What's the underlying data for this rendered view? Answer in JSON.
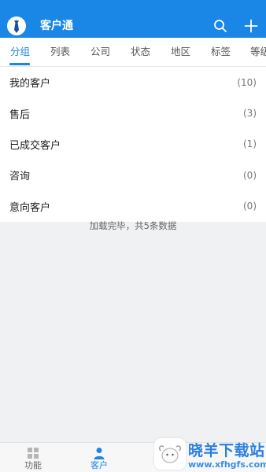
{
  "header": {
    "title": "客户通",
    "avatar_icon": "tie-icon",
    "search_icon": "search-icon",
    "add_icon": "plus-icon",
    "color": "#1a86e6"
  },
  "tabs": [
    {
      "label": "分组",
      "active": true
    },
    {
      "label": "列表"
    },
    {
      "label": "公司"
    },
    {
      "label": "状态"
    },
    {
      "label": "地区"
    },
    {
      "label": "标签"
    },
    {
      "label": "等级"
    }
  ],
  "groups": [
    {
      "label": "我的客户",
      "count": "(10)"
    },
    {
      "label": "售后",
      "count": "(3)"
    },
    {
      "label": "已成交客户",
      "count": "(1)"
    },
    {
      "label": "咨询",
      "count": "(0)"
    },
    {
      "label": "意向客户",
      "count": "(0)"
    }
  ],
  "footer": "加载完毕，共5条数据",
  "bottom_nav": [
    {
      "label": "功能",
      "icon": "grid-icon"
    },
    {
      "label": "客户",
      "icon": "person-icon",
      "active": true
    },
    {
      "label": "",
      "icon": "profile-icon"
    }
  ],
  "watermark": {
    "title": "晓羊下载站",
    "url": "www.xfhgfs.com"
  }
}
